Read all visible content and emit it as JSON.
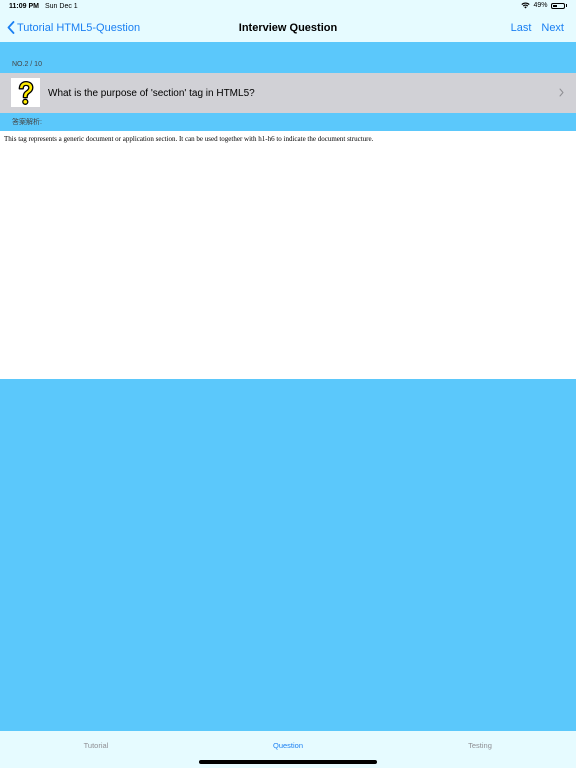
{
  "status_bar": {
    "time": "11:09 PM",
    "date": "Sun Dec 1",
    "battery_percent_label": "49%",
    "battery_level": 0.49,
    "wifi_icon": "wifi-icon",
    "battery_icon": "battery-icon"
  },
  "nav": {
    "back_label": "Tutorial HTML5-Question",
    "title": "Interview Question",
    "last_label": "Last",
    "next_label": "Next"
  },
  "question": {
    "counter": "NO.2 / 10",
    "text": "What is the purpose of 'section' tag in HTML5?",
    "icon": "question-mark-icon"
  },
  "answer": {
    "label": "答案解析:",
    "text": "This tag represents a generic document or application section. It can be used together with h1-h6 to indicate the document structure."
  },
  "tabs": [
    {
      "label": "Tutorial",
      "active": false
    },
    {
      "label": "Question",
      "active": true
    },
    {
      "label": "Testing",
      "active": false
    }
  ],
  "colors": {
    "background": "#5bc8fb",
    "bar_background": "#e6fbff",
    "accent": "#1a7ff2",
    "row_background": "#d1d1d6",
    "icon_yellow": "#ffeb00"
  }
}
